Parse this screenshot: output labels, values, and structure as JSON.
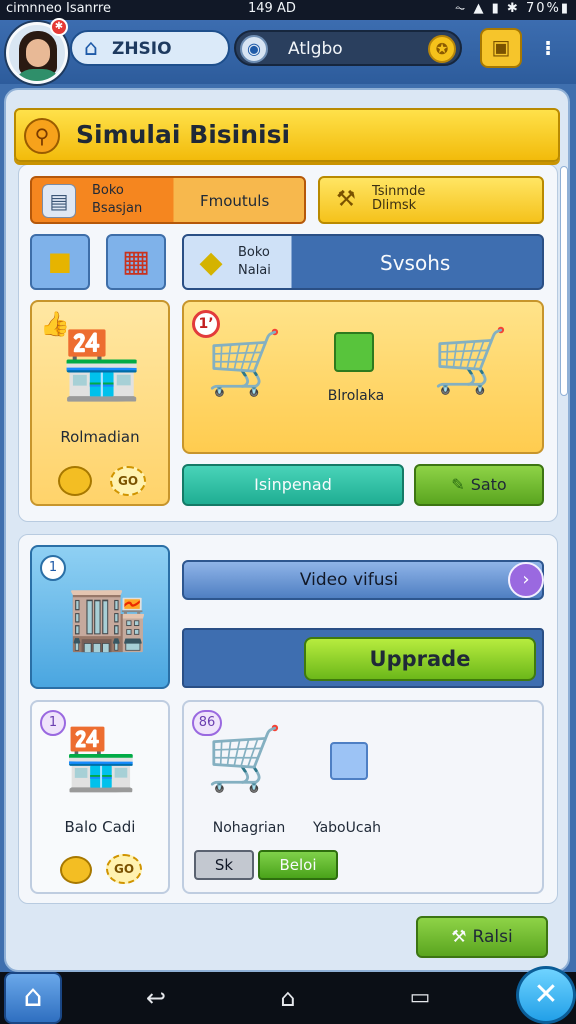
{
  "statusbar": {
    "left": "cimnneo Ιsanrre",
    "time": "149 AD",
    "right": "⏦ ▲ ▮ ✱ 70%▮"
  },
  "topbar": {
    "city_label": "ZHSIO",
    "search_label": "Atlgbo",
    "notification_count": "✱"
  },
  "title": {
    "text": "Simulai Bisinisi"
  },
  "tabs": {
    "orange_line1": "Boko",
    "orange_line2": "Bsasjan",
    "orange_right": "Fmoutuls",
    "yellow_line1": "Tsinmde",
    "yellow_line2": "Dlimsk",
    "blue_line1": "Boko",
    "blue_line2": "Nalai",
    "blue_right": "Svsohs"
  },
  "store_card": {
    "label": "Rolmadian",
    "coin_text": "GO"
  },
  "big_card": {
    "badge": "1’",
    "label": "Blrolaka"
  },
  "buttons": {
    "teal": "Isinpenad",
    "green": "Sato",
    "upgrade": "Upprade",
    "sk": "Sk",
    "beloi": "Beloi",
    "ralsi": "Ralsi"
  },
  "vend_card": {
    "num": "1"
  },
  "video_bar": {
    "label": "Video vifusi"
  },
  "small_store": {
    "num": "1",
    "label": "Balo Cadi",
    "coin_text": "GO"
  },
  "cart_card": {
    "num": "86",
    "label1": "Nohagrian",
    "label2": "YaboUcah"
  },
  "icons": {
    "city": "house-icon",
    "globe": "globe-icon",
    "coin": "coin-icon",
    "map": "map-icon",
    "more": "more-icon",
    "title": "magnifier-icon",
    "close": "close-icon",
    "home": "home-icon"
  },
  "colors": {
    "brand_blue": "#3e6eb0",
    "accent_yellow": "#f5c21b",
    "accent_green": "#6cb81a",
    "accent_orange": "#f5861f"
  }
}
